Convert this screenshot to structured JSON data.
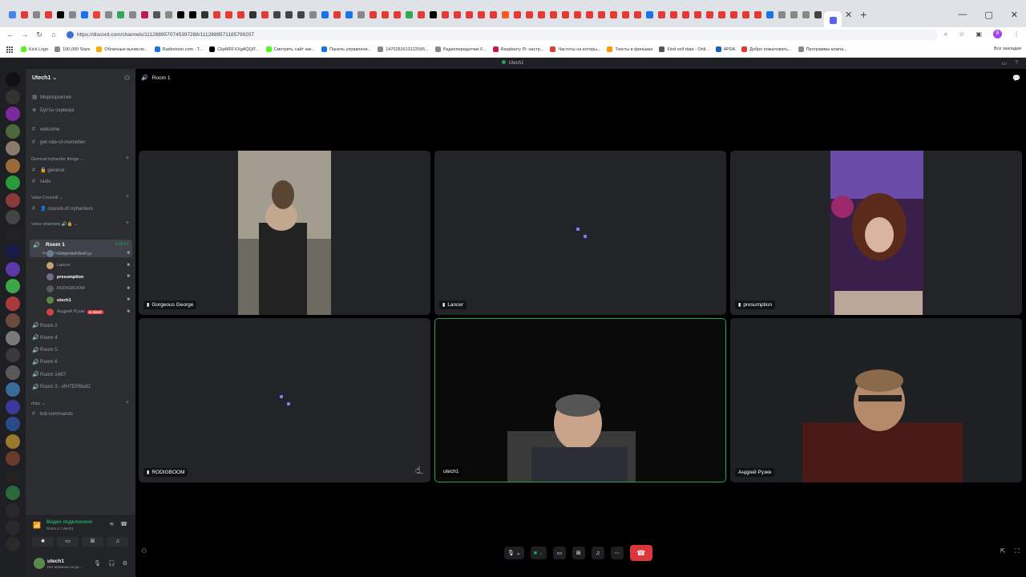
{
  "browser": {
    "url": "https://discord.com/channels/1112889570745397288/1112889571185799207",
    "bookmarks": [
      {
        "label": "Kick Logo",
        "color": "#53fc18"
      },
      {
        "label": "100,000 Stars",
        "color": "#888888"
      },
      {
        "label": "Облачные вычисле...",
        "color": "#f9ab00"
      },
      {
        "label": "Radiooooo.com - T...",
        "color": "#1a73e8"
      },
      {
        "label": "CkpMFFXXgAQQiT...",
        "color": "#000000"
      },
      {
        "label": "Смотреть сайт как...",
        "color": "#53fc18"
      },
      {
        "label": "Панель управлени...",
        "color": "#1a73e8"
      },
      {
        "label": "1470282613122595...",
        "color": "#888888"
      },
      {
        "label": "Радиопередатчик F...",
        "color": "#888888"
      },
      {
        "label": "Raspberry Pi: настр...",
        "color": "#c51a4a"
      },
      {
        "label": "Частоты на которы...",
        "color": "#e53935"
      },
      {
        "label": "Тексты в фильмах",
        "color": "#ff9800"
      },
      {
        "label": "Find exif data - Onli...",
        "color": "#555555"
      },
      {
        "label": "4PDA",
        "color": "#1565c0"
      },
      {
        "label": "Добро пожаловать...",
        "color": "#e53935"
      },
      {
        "label": "Программы компа...",
        "color": "#888888"
      }
    ],
    "all_bookmarks": "Все закладки"
  },
  "discord": {
    "window_title": "Utech1",
    "server_name": "Utech1",
    "top_items": [
      {
        "label": "Мероприятия"
      },
      {
        "label": "Бусты сервера"
      }
    ],
    "text_channels": [
      {
        "label": "welcome"
      },
      {
        "label": "get-role-of-memeber"
      }
    ],
    "categories": {
      "general": "General tryharder things",
      "valar": "Valar Councill",
      "voice": "voice channels 🔊🔒",
      "misc": "misc"
    },
    "general_channels": [
      {
        "label": "🔒 general"
      },
      {
        "label": "raids"
      }
    ],
    "valar_channels": [
      {
        "label": "👤 council-of-tryharders"
      }
    ],
    "active_room": {
      "name": "Room 1",
      "sub": "Выбрать статус канала 🖉",
      "time": "3:18:13"
    },
    "members": [
      {
        "name": "Gorgeous George",
        "color": "#6b7b8c",
        "bold": false,
        "live": ""
      },
      {
        "name": "Lancer",
        "color": "#c9a06a",
        "bold": false,
        "live": ""
      },
      {
        "name": "presumption",
        "color": "#7a6a8a",
        "bold": true,
        "live": ""
      },
      {
        "name": "RODIGBOOM",
        "color": "#5a5a5a",
        "bold": false,
        "live": ""
      },
      {
        "name": "utech1",
        "color": "#5a8a4a",
        "bold": true,
        "live": ""
      },
      {
        "name": "Андрей Рузке",
        "color": "#c44",
        "bold": false,
        "live": "В ЭФИР"
      }
    ],
    "voice_rooms": [
      {
        "label": "Room 2"
      },
      {
        "label": "Room 4"
      },
      {
        "label": "Room 5"
      },
      {
        "label": "Room 6"
      },
      {
        "label": "Room 1487"
      },
      {
        "label": "Room 3 - ИНТЕРВЬЮ"
      }
    ],
    "misc_channels": [
      {
        "label": "bot-commands"
      }
    ],
    "voice_panel": {
      "status": "Видео подключено",
      "sub": "Room 1 / Utech1"
    },
    "user": {
      "name": "utech1",
      "status": "Нет времени на ра..."
    },
    "stage_title": "Room 1",
    "tiles": [
      {
        "name": "Gorgeous George"
      },
      {
        "name": "Lancer"
      },
      {
        "name": "presumption"
      },
      {
        "name": "RODIGBOOM"
      },
      {
        "name": "utech1"
      },
      {
        "name": "Андрей Рузке"
      }
    ]
  }
}
